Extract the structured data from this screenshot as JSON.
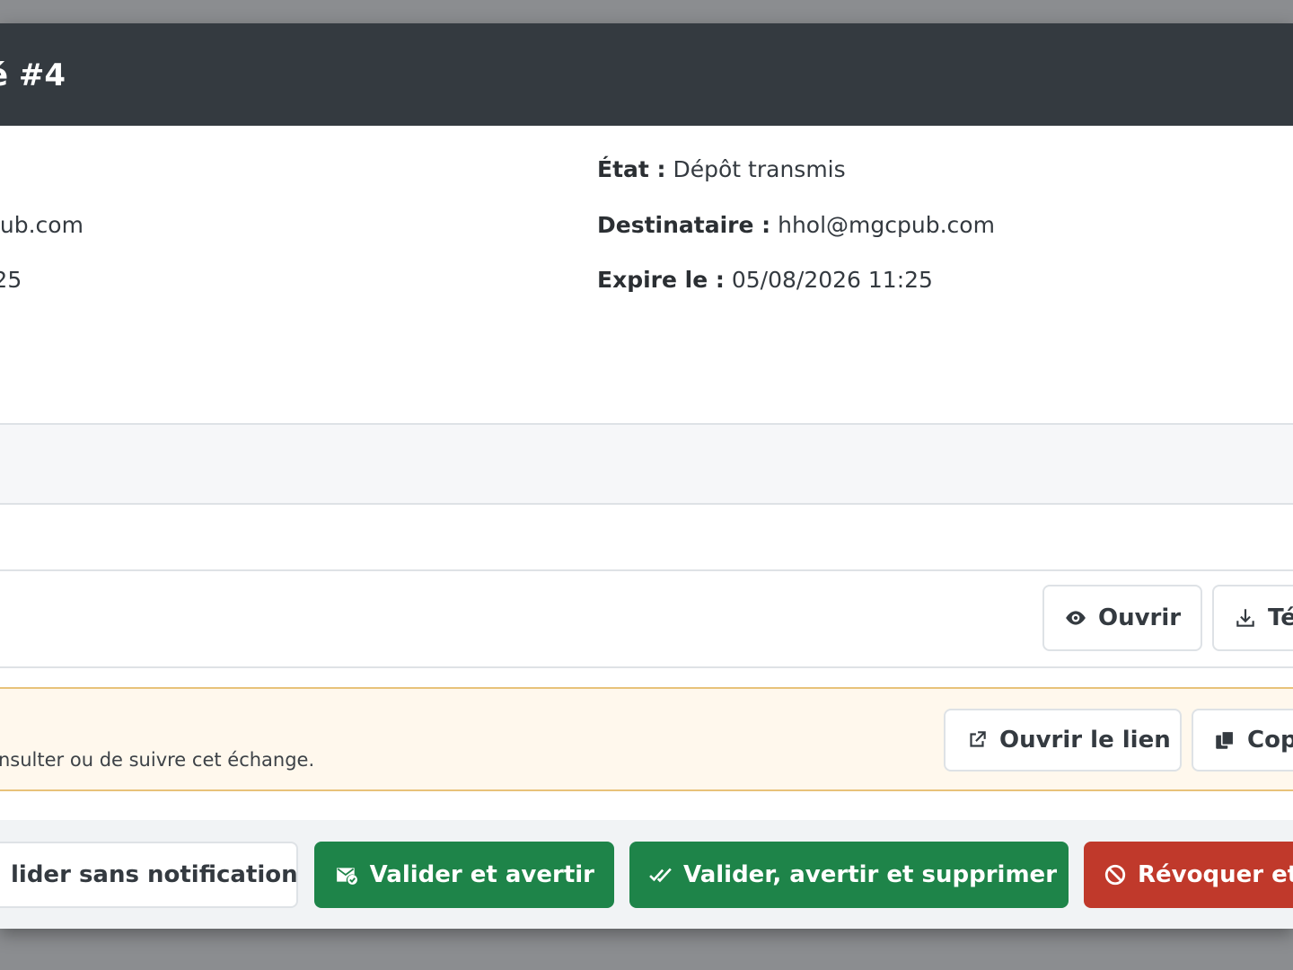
{
  "modal": {
    "title": "é #4"
  },
  "info": {
    "left": {
      "email_fragment": "pub.com",
      "time_fragment": ":25"
    },
    "state_label": "État :",
    "state_value": "Dépôt transmis",
    "recipient_label": "Destinataire :",
    "recipient_value": "hhol@mgcpub.com",
    "expires_label": "Expire le :",
    "expires_value": "05/08/2026 11:25"
  },
  "file_actions": {
    "open_label": "Ouvrir",
    "download_label": "Té"
  },
  "share": {
    "note": "nsulter ou de suivre cet échange.",
    "open_link_label": "Ouvrir le lien",
    "copy_label": "Cop"
  },
  "footer": {
    "validate_silent_label": "lider sans notification",
    "validate_notify_label": "Valider et avertir",
    "validate_notify_delete_label": "Valider, avertir et supprimer",
    "revoke_label": "Révoquer et"
  },
  "colors": {
    "header_bg": "#343a40",
    "success": "#1e8449",
    "danger": "#c0392b",
    "warning_border": "#e8c27a",
    "warning_bg": "#fff8ed"
  },
  "icons": {
    "open": "eye-icon",
    "download": "download-icon",
    "open_link": "external-link-icon",
    "copy": "copy-icon",
    "validate_notify": "envelope-check-icon",
    "validate_notify_delete": "double-check-icon",
    "revoke": "ban-icon"
  }
}
